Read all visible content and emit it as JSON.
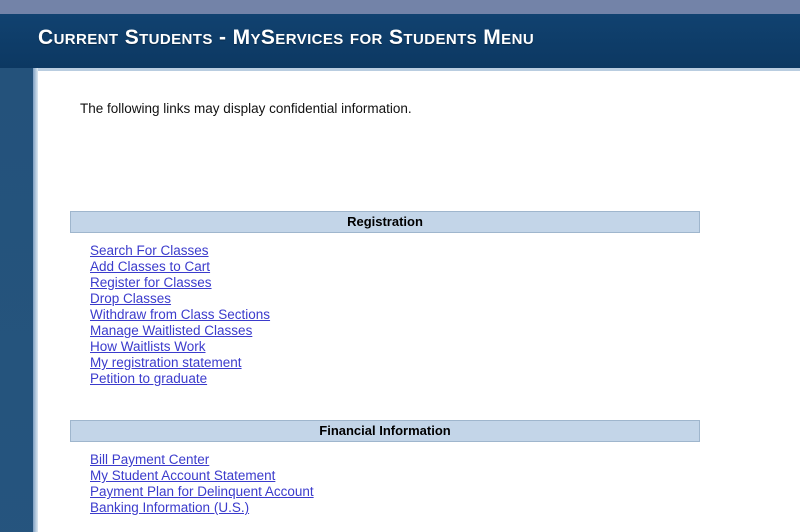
{
  "header": {
    "title": "Current Students - MyServices for Students Menu"
  },
  "colors": {
    "top_strip": "#7383a8",
    "header_band": "#0d3c66",
    "left_rail": "#25547d",
    "section_bar": "#c3d5e8",
    "section_bar_border": "#9fb6cd",
    "link": "#3b3bcc",
    "body_text": "#111111",
    "panel_background": "#ffffff"
  },
  "content": {
    "intro_text": "The following links may display confidential information."
  },
  "sections": [
    {
      "id": "registration",
      "heading": "Registration",
      "links": [
        "Search For Classes",
        "Add Classes to Cart",
        "Register for Classes",
        "Drop Classes",
        "Withdraw from Class Sections",
        "Manage Waitlisted Classes",
        "How Waitlists Work",
        "My registration statement",
        "Petition to graduate"
      ]
    },
    {
      "id": "financial-information",
      "heading": "Financial Information",
      "links": [
        "Bill Payment Center",
        "My Student Account Statement",
        "Payment Plan for Delinquent Account",
        "Banking Information (U.S.)"
      ]
    }
  ]
}
